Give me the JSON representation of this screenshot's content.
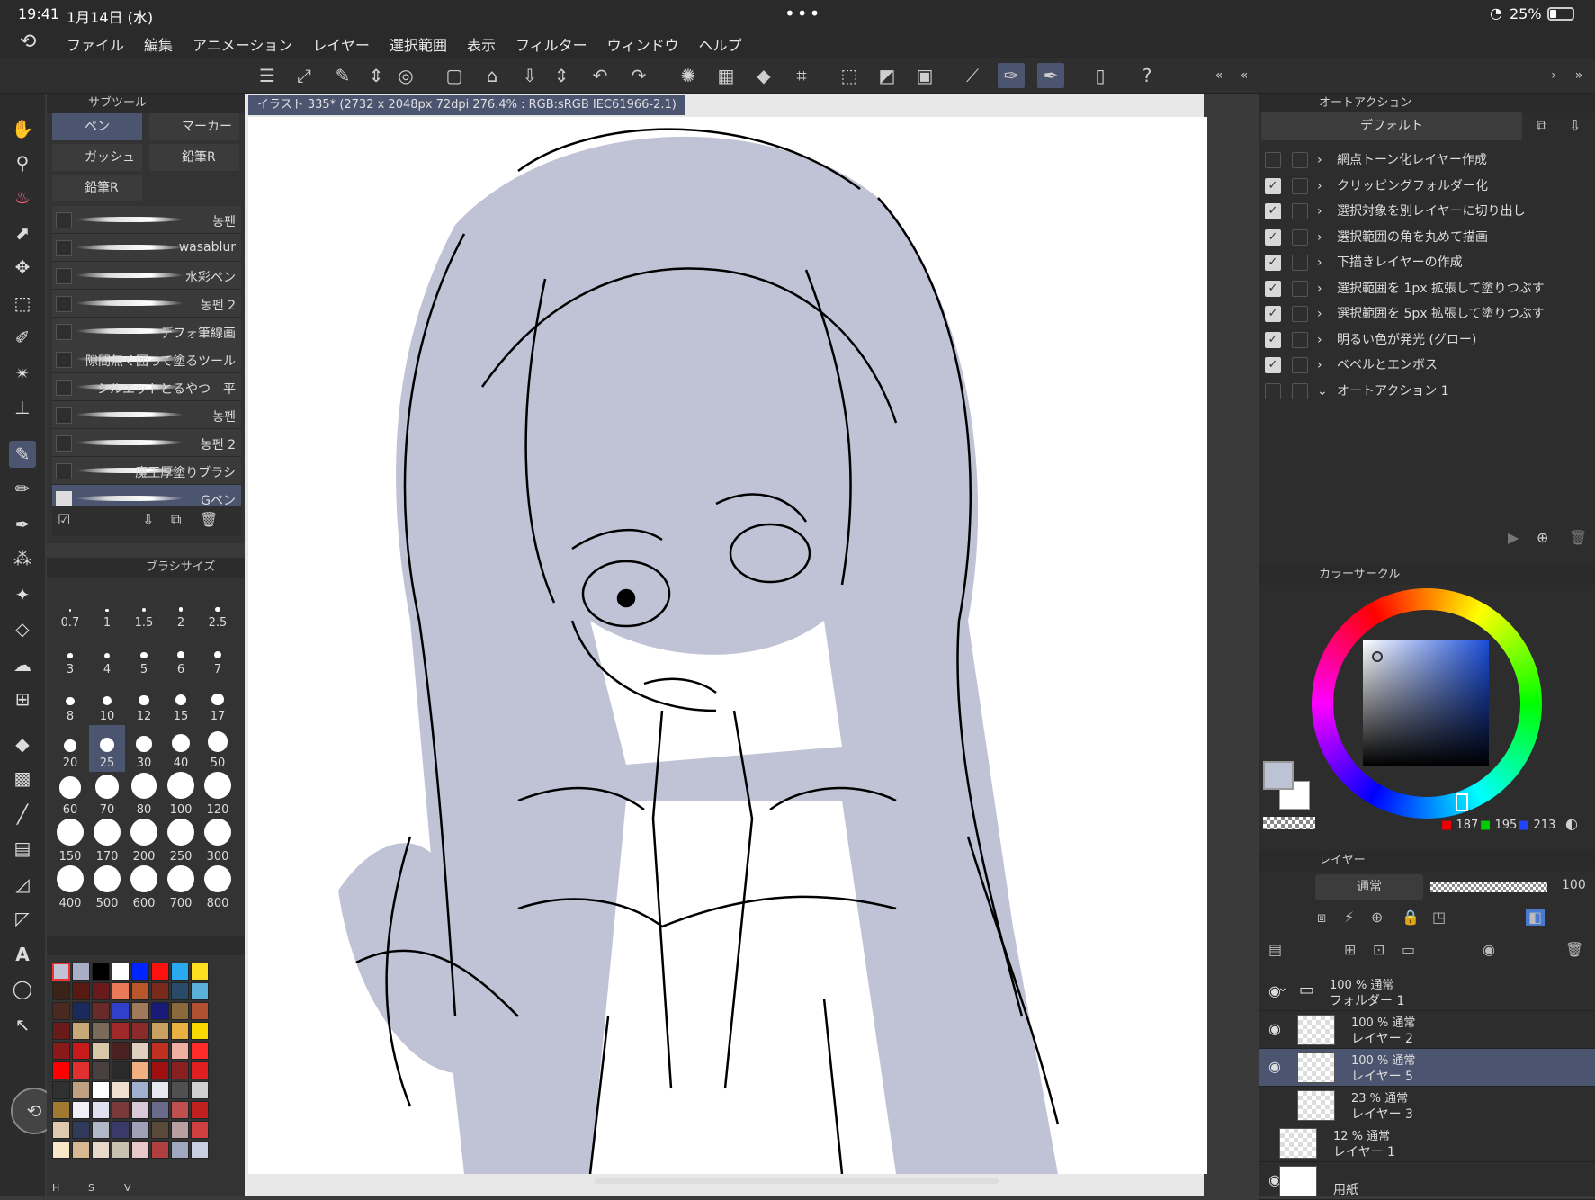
{
  "status": {
    "time": "19:41",
    "date": "1月14日 (水)",
    "battery": "25%"
  },
  "menu": [
    "ファイル",
    "編集",
    "アニメーション",
    "レイヤー",
    "選択範囲",
    "表示",
    "フィルター",
    "ウィンドウ",
    "ヘルプ"
  ],
  "document": {
    "tab_title": "イラスト 335* (2732 x 2048px 72dpi 276.4% : RGB:sRGB IEC61966-2.1)"
  },
  "subtool": {
    "panel_title": "サブツール",
    "tabs": [
      "ペン",
      "マーカー",
      "ガッシュな",
      "鉛筆R",
      "鉛筆R"
    ],
    "brushes": [
      {
        "name": "농펜",
        "checked": false
      },
      {
        "name": "wasablur",
        "checked": false
      },
      {
        "name": "水彩ペン",
        "checked": false
      },
      {
        "name": "농펜 2",
        "checked": false
      },
      {
        "name": "デフォ筆線画",
        "checked": false
      },
      {
        "name": "隙間無く囲って塗るツール",
        "checked": false
      },
      {
        "name": "シルエットとるやつ　平",
        "checked": false
      },
      {
        "name": "농펜",
        "checked": false
      },
      {
        "name": "농펜 2",
        "checked": false
      },
      {
        "name": "魔王厚塗りブラシ",
        "checked": false
      },
      {
        "name": "Gペン",
        "checked": true
      }
    ]
  },
  "brush_size": {
    "panel_title": "ブラシサイズ",
    "sizes": [
      "0.7",
      "1",
      "1.5",
      "2",
      "2.5",
      "3",
      "4",
      "5",
      "6",
      "7",
      "8",
      "10",
      "12",
      "15",
      "17",
      "20",
      "25",
      "30",
      "40",
      "50",
      "60",
      "70",
      "80",
      "100",
      "120",
      "150",
      "170",
      "200",
      "250",
      "300",
      "400",
      "500",
      "600",
      "700",
      "800"
    ],
    "selected": "25"
  },
  "palette": {
    "colors": [
      "#bfc3d5",
      "#a9aec8",
      "#000000",
      "#ffffff",
      "#0024ff",
      "#ff1010",
      "#2aa9f0",
      "#ffe020",
      "#3a2418",
      "#5a1a14",
      "#6a1a1a",
      "#e87a5a",
      "#b9562a",
      "#7a2a1a",
      "#2a4a6a",
      "#5ab0d8",
      "#4a2a20",
      "#1a2a5a",
      "#6a2a2a",
      "#3040c8",
      "#a07a5a",
      "#1a1a7a",
      "#8a6a3a",
      "#b05030",
      "#6a1a18",
      "#c8a878",
      "#7a6a5a",
      "#a02a2a",
      "#8a2a2a",
      "#c8a060",
      "#e8b040",
      "#f8d800",
      "#8a1a1a",
      "#c81a1a",
      "#d8c8a8",
      "#4a2020",
      "#e0d0c0",
      "#c03020",
      "#f0b0a0",
      "#ff2a2a",
      "#ff0000",
      "#e03030",
      "#4a4040",
      "#2a2a2a",
      "#f0b080",
      "#a01010",
      "#8a2020",
      "#e02020",
      "#303030",
      "#c0a080",
      "#ffffff",
      "#f0e0d0",
      "#a0b0d0",
      "#e8e8f0",
      "#505050",
      "#d0d0d0",
      "#a07a30",
      "#f0f0f8",
      "#e0e0f0",
      "#7a3a3a",
      "#d8c8d8",
      "#6a6a8a",
      "#c05050",
      "#c02020",
      "#e0c8b0",
      "#303a5a",
      "#b0b8c8",
      "#3a3a6a",
      "#a0a0b8",
      "#5a4a3a",
      "#b8a0a0",
      "#d04040",
      "#f8e8c8",
      "#d8b890",
      "#e8d8c8",
      "#c8c0b0",
      "#e8c8c8",
      "#b04040",
      "#a0a8c0",
      "#c8d0e0"
    ],
    "labels": [
      "H",
      "S",
      "V"
    ]
  },
  "auto_action": {
    "panel_title": "オートアクション",
    "set_name": "デフォルト",
    "actions": [
      {
        "label": "網点トーン化レイヤー作成",
        "checked": false,
        "expanded": false
      },
      {
        "label": "クリッピングフォルダー化",
        "checked": true,
        "expanded": false
      },
      {
        "label": "選択対象を別レイヤーに切り出し",
        "checked": true,
        "expanded": false
      },
      {
        "label": "選択範囲の角を丸めて描画",
        "checked": true,
        "expanded": false
      },
      {
        "label": "下描きレイヤーの作成",
        "checked": true,
        "expanded": false
      },
      {
        "label": "選択範囲を 1px 拡張して塗りつぶす",
        "checked": true,
        "expanded": false
      },
      {
        "label": "選択範囲を 5px 拡張して塗りつぶす",
        "checked": true,
        "expanded": false
      },
      {
        "label": "明るい色が発光 (グロー)",
        "checked": true,
        "expanded": false
      },
      {
        "label": "ベベルとエンボス",
        "checked": true,
        "expanded": false
      },
      {
        "label": "オートアクション 1",
        "checked": false,
        "expanded": true
      }
    ]
  },
  "color_circle": {
    "panel_title": "カラーサークル",
    "main_color": "#bbc3d5",
    "r": "187",
    "g": "195",
    "b": "213"
  },
  "layers": {
    "panel_title": "レイヤー",
    "blend_mode": "通常",
    "opacity": "100",
    "items": [
      {
        "meta": "100 % 通常",
        "name": "フォルダー 1",
        "type": "folder"
      },
      {
        "meta": "100 % 通常",
        "name": "レイヤー 2",
        "type": "layer"
      },
      {
        "meta": "100 % 通常",
        "name": "レイヤー 5",
        "type": "layer",
        "selected": true
      },
      {
        "meta": "23 % 通常",
        "name": "レイヤー 3",
        "type": "layer"
      },
      {
        "meta": "12 % 通常",
        "name": "レイヤー 1",
        "type": "layer"
      },
      {
        "meta": "",
        "name": "用紙",
        "type": "paper"
      }
    ]
  }
}
